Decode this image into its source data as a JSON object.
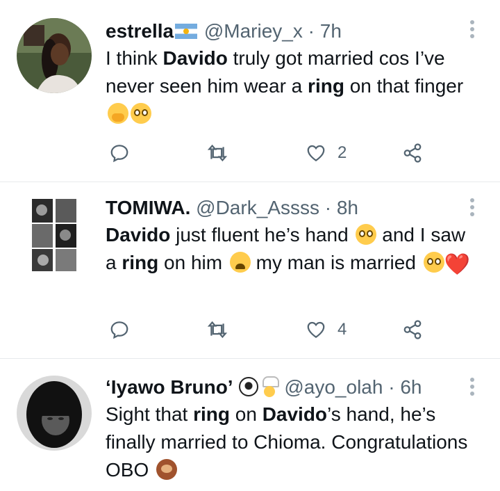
{
  "tweets": [
    {
      "name": "estrella",
      "name_flag_icon": "argentina-flag-icon",
      "handle": "@Mariey_x",
      "separator": "·",
      "time": "7h",
      "body": {
        "p1": "I think ",
        "b1": "Davido",
        "p2": " truly got married cos I’ve never seen him wear a ",
        "b2": "ring",
        "p3": " on that finger"
      },
      "like_count": "2"
    },
    {
      "name": "TOMIWA.",
      "handle": "@Dark_Assss",
      "separator": "·",
      "time": "8h",
      "body": {
        "b1": "Davido",
        "p1": " just fluent he’s hand ",
        "p2": " and I saw a ",
        "b2": "ring",
        "p3": " on him ",
        "p4": " my man is married "
      },
      "heart_emoji": "❤️",
      "like_count": "4"
    },
    {
      "name": "‘Iyawo Bruno’",
      "handle": "@ayo_olah",
      "separator": "·",
      "time": "6h",
      "body": {
        "p1": "Sight that ",
        "b1": "ring",
        "p2": " on ",
        "b2": "Davido",
        "p3": "’s hand, he’s finally married to Chioma. Congratulations OBO "
      }
    }
  ],
  "colors": {
    "text": "#0f1419",
    "secondary": "#536471",
    "divider": "#e7eaec"
  }
}
